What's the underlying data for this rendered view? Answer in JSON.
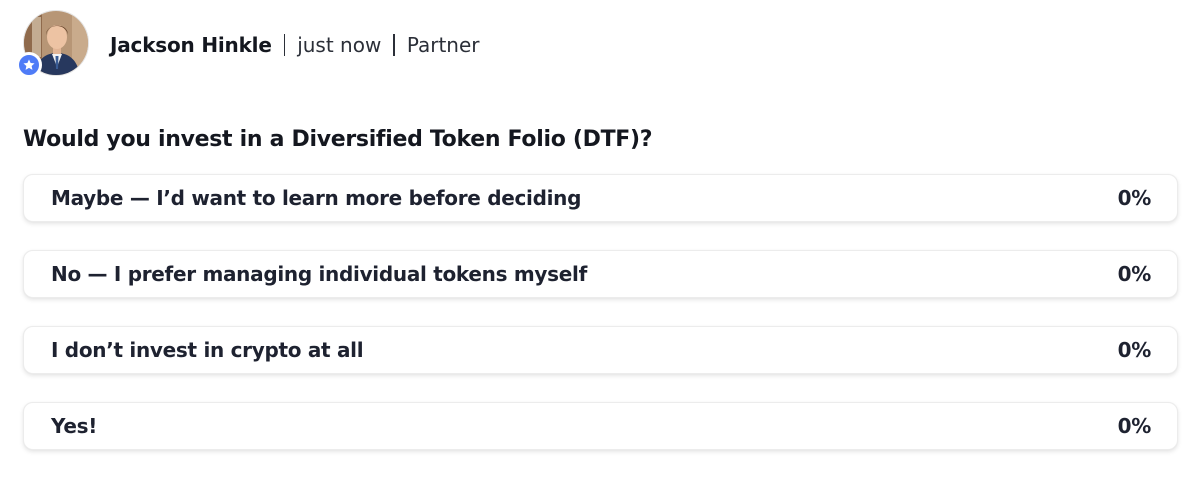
{
  "author": {
    "name": "Jackson Hinkle",
    "time": "just now",
    "role": "Partner",
    "badge_icon": "star-icon",
    "badge_color": "#4f7cf7"
  },
  "poll": {
    "question": "Would you invest in a Diversified Token Folio (DTF)?",
    "options": [
      {
        "label": "Maybe — I’d want to learn more before deciding",
        "percent": "0%",
        "fraction": 0
      },
      {
        "label": "No — I prefer managing individual tokens myself",
        "percent": "0%",
        "fraction": 0
      },
      {
        "label": "I don’t invest in crypto at all",
        "percent": "0%",
        "fraction": 0
      },
      {
        "label": "Yes!",
        "percent": "0%",
        "fraction": 0
      }
    ]
  }
}
